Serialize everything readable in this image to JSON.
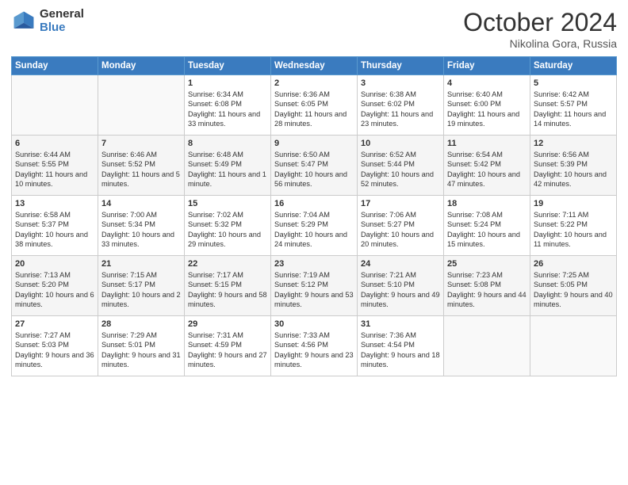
{
  "header": {
    "logo_general": "General",
    "logo_blue": "Blue",
    "month": "October 2024",
    "location": "Nikolina Gora, Russia"
  },
  "days_of_week": [
    "Sunday",
    "Monday",
    "Tuesday",
    "Wednesday",
    "Thursday",
    "Friday",
    "Saturday"
  ],
  "weeks": [
    [
      {
        "day": "",
        "info": ""
      },
      {
        "day": "",
        "info": ""
      },
      {
        "day": "1",
        "info": "Sunrise: 6:34 AM\nSunset: 6:08 PM\nDaylight: 11 hours and 33 minutes."
      },
      {
        "day": "2",
        "info": "Sunrise: 6:36 AM\nSunset: 6:05 PM\nDaylight: 11 hours and 28 minutes."
      },
      {
        "day": "3",
        "info": "Sunrise: 6:38 AM\nSunset: 6:02 PM\nDaylight: 11 hours and 23 minutes."
      },
      {
        "day": "4",
        "info": "Sunrise: 6:40 AM\nSunset: 6:00 PM\nDaylight: 11 hours and 19 minutes."
      },
      {
        "day": "5",
        "info": "Sunrise: 6:42 AM\nSunset: 5:57 PM\nDaylight: 11 hours and 14 minutes."
      }
    ],
    [
      {
        "day": "6",
        "info": "Sunrise: 6:44 AM\nSunset: 5:55 PM\nDaylight: 11 hours and 10 minutes."
      },
      {
        "day": "7",
        "info": "Sunrise: 6:46 AM\nSunset: 5:52 PM\nDaylight: 11 hours and 5 minutes."
      },
      {
        "day": "8",
        "info": "Sunrise: 6:48 AM\nSunset: 5:49 PM\nDaylight: 11 hours and 1 minute."
      },
      {
        "day": "9",
        "info": "Sunrise: 6:50 AM\nSunset: 5:47 PM\nDaylight: 10 hours and 56 minutes."
      },
      {
        "day": "10",
        "info": "Sunrise: 6:52 AM\nSunset: 5:44 PM\nDaylight: 10 hours and 52 minutes."
      },
      {
        "day": "11",
        "info": "Sunrise: 6:54 AM\nSunset: 5:42 PM\nDaylight: 10 hours and 47 minutes."
      },
      {
        "day": "12",
        "info": "Sunrise: 6:56 AM\nSunset: 5:39 PM\nDaylight: 10 hours and 42 minutes."
      }
    ],
    [
      {
        "day": "13",
        "info": "Sunrise: 6:58 AM\nSunset: 5:37 PM\nDaylight: 10 hours and 38 minutes."
      },
      {
        "day": "14",
        "info": "Sunrise: 7:00 AM\nSunset: 5:34 PM\nDaylight: 10 hours and 33 minutes."
      },
      {
        "day": "15",
        "info": "Sunrise: 7:02 AM\nSunset: 5:32 PM\nDaylight: 10 hours and 29 minutes."
      },
      {
        "day": "16",
        "info": "Sunrise: 7:04 AM\nSunset: 5:29 PM\nDaylight: 10 hours and 24 minutes."
      },
      {
        "day": "17",
        "info": "Sunrise: 7:06 AM\nSunset: 5:27 PM\nDaylight: 10 hours and 20 minutes."
      },
      {
        "day": "18",
        "info": "Sunrise: 7:08 AM\nSunset: 5:24 PM\nDaylight: 10 hours and 15 minutes."
      },
      {
        "day": "19",
        "info": "Sunrise: 7:11 AM\nSunset: 5:22 PM\nDaylight: 10 hours and 11 minutes."
      }
    ],
    [
      {
        "day": "20",
        "info": "Sunrise: 7:13 AM\nSunset: 5:20 PM\nDaylight: 10 hours and 6 minutes."
      },
      {
        "day": "21",
        "info": "Sunrise: 7:15 AM\nSunset: 5:17 PM\nDaylight: 10 hours and 2 minutes."
      },
      {
        "day": "22",
        "info": "Sunrise: 7:17 AM\nSunset: 5:15 PM\nDaylight: 9 hours and 58 minutes."
      },
      {
        "day": "23",
        "info": "Sunrise: 7:19 AM\nSunset: 5:12 PM\nDaylight: 9 hours and 53 minutes."
      },
      {
        "day": "24",
        "info": "Sunrise: 7:21 AM\nSunset: 5:10 PM\nDaylight: 9 hours and 49 minutes."
      },
      {
        "day": "25",
        "info": "Sunrise: 7:23 AM\nSunset: 5:08 PM\nDaylight: 9 hours and 44 minutes."
      },
      {
        "day": "26",
        "info": "Sunrise: 7:25 AM\nSunset: 5:05 PM\nDaylight: 9 hours and 40 minutes."
      }
    ],
    [
      {
        "day": "27",
        "info": "Sunrise: 7:27 AM\nSunset: 5:03 PM\nDaylight: 9 hours and 36 minutes."
      },
      {
        "day": "28",
        "info": "Sunrise: 7:29 AM\nSunset: 5:01 PM\nDaylight: 9 hours and 31 minutes."
      },
      {
        "day": "29",
        "info": "Sunrise: 7:31 AM\nSunset: 4:59 PM\nDaylight: 9 hours and 27 minutes."
      },
      {
        "day": "30",
        "info": "Sunrise: 7:33 AM\nSunset: 4:56 PM\nDaylight: 9 hours and 23 minutes."
      },
      {
        "day": "31",
        "info": "Sunrise: 7:36 AM\nSunset: 4:54 PM\nDaylight: 9 hours and 18 minutes."
      },
      {
        "day": "",
        "info": ""
      },
      {
        "day": "",
        "info": ""
      }
    ]
  ]
}
